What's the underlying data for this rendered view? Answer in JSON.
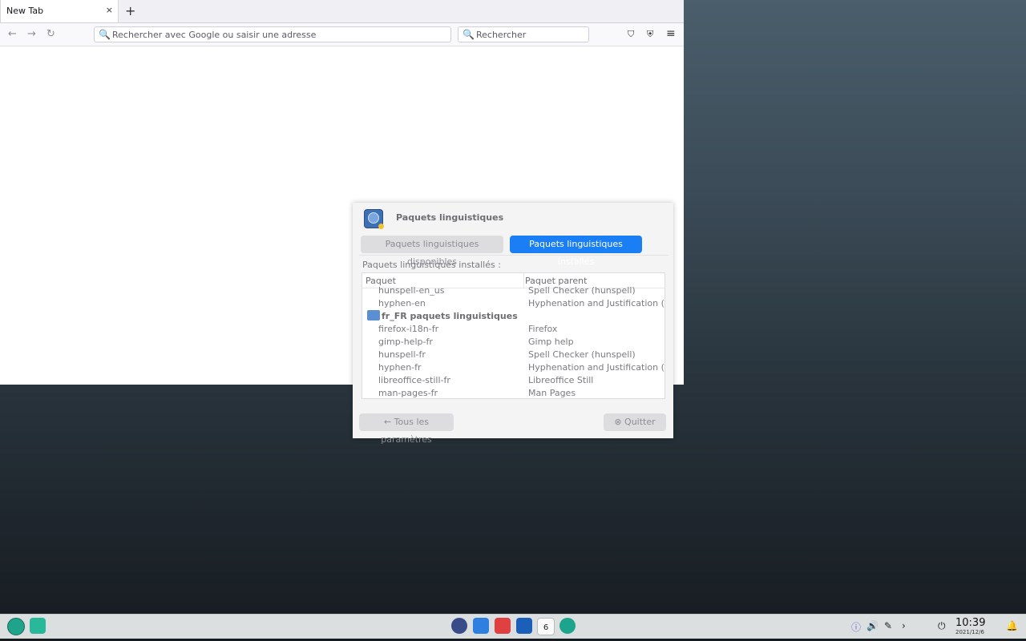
{
  "browser": {
    "tab_title": "New Tab",
    "tab_close": "×",
    "new_tab": "+",
    "nav": {
      "back": "←",
      "forward": "→",
      "reload": "↻"
    },
    "url_placeholder": "Rechercher avec Google ou saisir une adresse",
    "search_placeholder": "Rechercher",
    "search_glyph": "🔍",
    "toolbar": {
      "pocket": "⛉",
      "shield": "⛨",
      "menu": "≡"
    }
  },
  "dialog": {
    "title": "Paquets linguistiques",
    "tabs": [
      "Paquets linguistiques disponibles",
      "Paquets linguistiques installés"
    ],
    "active_tab": 1,
    "section_label": "Paquets linguistiques installés :",
    "columns": [
      "Paquet",
      "Paquet parent"
    ],
    "rows": [
      {
        "package": "hunspell-en_us",
        "parent": "Spell Checker (hunspell)"
      },
      {
        "package": "hyphen-en",
        "parent": "Hyphenation and Justification (hyphen)"
      },
      {
        "package": "fr_FR paquets linguistiques",
        "parent": "",
        "group": true
      },
      {
        "package": "firefox-i18n-fr",
        "parent": "Firefox"
      },
      {
        "package": "gimp-help-fr",
        "parent": "Gimp help"
      },
      {
        "package": "hunspell-fr",
        "parent": "Spell Checker (hunspell)"
      },
      {
        "package": "hyphen-fr",
        "parent": "Hyphenation and Justification (hyphen)"
      },
      {
        "package": "libreoffice-still-fr",
        "parent": "Libreoffice Still"
      },
      {
        "package": "man-pages-fr",
        "parent": "Man Pages"
      }
    ],
    "back_button": "← Tous les paramètres",
    "quit_button": "⊗ Quitter"
  },
  "taskbar": {
    "calendar_day": "6",
    "time": "10:39",
    "date": "2021/12/6",
    "tray": {
      "info": "ⓘ",
      "volume": "🔊",
      "pen": "✎",
      "expand": "›",
      "power": "⏻",
      "bell": "🔔"
    },
    "colors": {
      "accent": "#1a7ff5",
      "launcher": "#1fa38a",
      "terminal": "#e04040",
      "store": "#2f7fe0"
    }
  }
}
